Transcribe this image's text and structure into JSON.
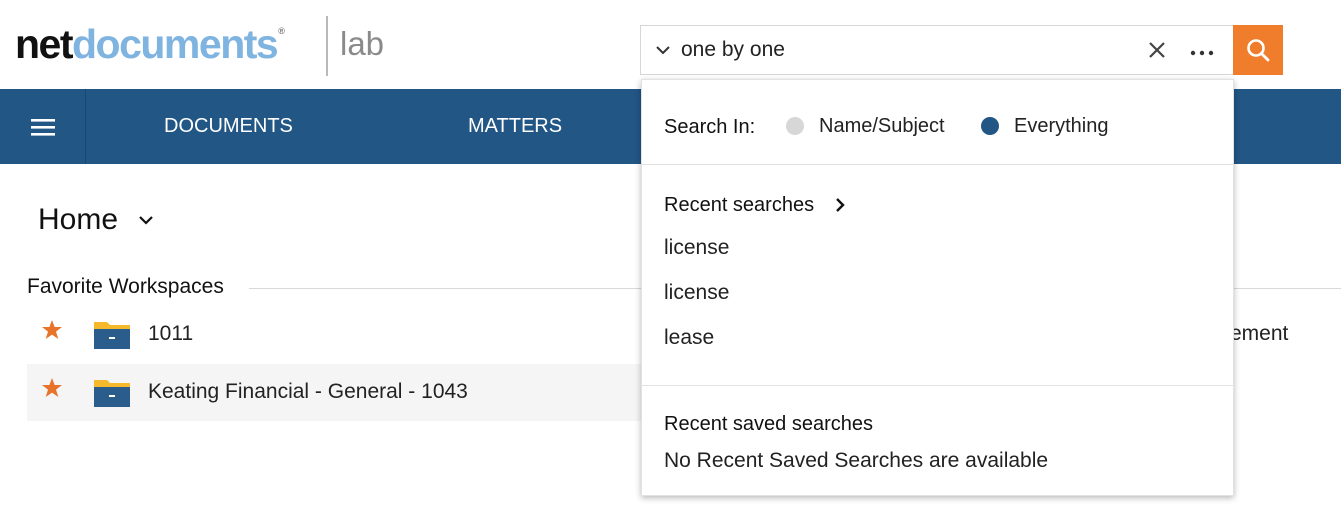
{
  "header": {
    "logo_part1": "net",
    "logo_part2": "documents",
    "logo_mark": "®",
    "lab_label": "lab",
    "search": {
      "value": "one by one",
      "placeholder": ""
    },
    "search_button_color": "#f07d2c"
  },
  "nav": {
    "items": [
      {
        "label": "DOCUMENTS"
      },
      {
        "label": "MATTERS"
      }
    ],
    "background": "#225685"
  },
  "main": {
    "title": "Home",
    "favorites_title": "Favorite Workspaces",
    "workspaces": [
      {
        "name": "1011"
      },
      {
        "name": "Keating Financial - General - 1043"
      }
    ],
    "clipped_text": "ement"
  },
  "dropdown": {
    "search_in_label": "Search In:",
    "options": [
      {
        "label": "Name/Subject",
        "selected": false
      },
      {
        "label": "Everything",
        "selected": true
      }
    ],
    "recent_searches_title": "Recent searches",
    "recent_searches": [
      "license",
      "license",
      "lease"
    ],
    "recent_saved_title": "Recent saved searches",
    "recent_saved_empty": "No Recent Saved Searches are available"
  },
  "colors": {
    "accent_orange": "#f07d2c",
    "brand_blue": "#225685",
    "logo_light_blue": "#7fb3e0",
    "star": "#e8732a",
    "folder_yellow": "#f6b92b",
    "folder_blue": "#2a5d8c"
  }
}
